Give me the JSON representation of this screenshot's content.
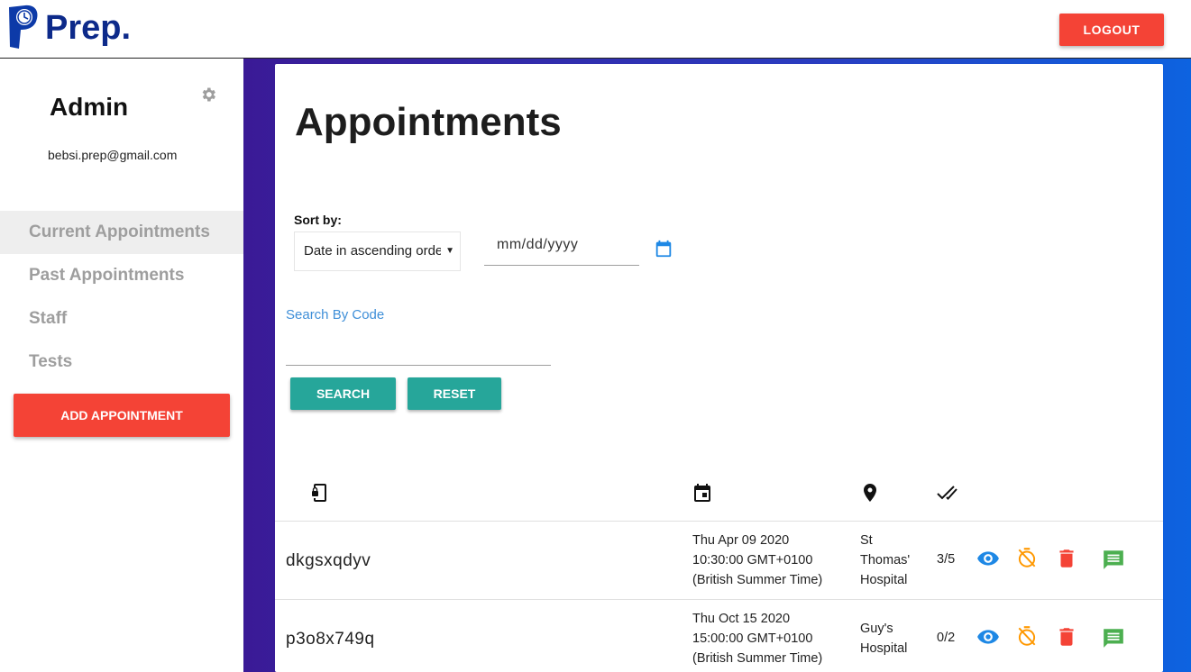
{
  "header": {
    "brand": "Prep.",
    "logout_label": "LOGOUT"
  },
  "sidebar": {
    "admin_name": "Admin",
    "admin_email": "bebsi.prep@gmail.com",
    "settings_icon": "gear-icon",
    "items": [
      {
        "label": "Current Appointments",
        "active": true
      },
      {
        "label": "Past Appointments",
        "active": false
      },
      {
        "label": "Staff",
        "active": false
      },
      {
        "label": "Tests",
        "active": false
      }
    ],
    "add_label": "ADD APPOINTMENT"
  },
  "main": {
    "title": "Appointments",
    "sort_label": "Sort by:",
    "sort_value": "Date in ascending order",
    "date_placeholder": "mm/dd/yyyy",
    "search_label": "Search By Code",
    "search_value": "",
    "search_button": "SEARCH",
    "reset_button": "RESET",
    "columns": [
      "phone-icon",
      "calendar-icon",
      "location-pin-icon",
      "checkmark-icon"
    ],
    "rows": [
      {
        "code": "dkgsxqdyv",
        "date_line1": "Thu Apr 09 2020",
        "date_line2": "10:30:00 GMT+0100",
        "date_line3": "(British Summer Time)",
        "loc_line1": "St",
        "loc_line2": "Thomas'",
        "loc_line3": "Hospital",
        "score": "3/5"
      },
      {
        "code": "p3o8x749q",
        "date_line1": "Thu Oct 15 2020",
        "date_line2": "15:00:00 GMT+0100",
        "date_line3": "(British Summer Time)",
        "loc_line1": "Guy's",
        "loc_line2": "Hospital",
        "loc_line3": "",
        "score": "0/2"
      }
    ]
  },
  "colors": {
    "brand_blue": "#0d2a8a",
    "red": "#f44336",
    "teal": "#26a69a",
    "link_blue": "#3f8fd8",
    "view_blue": "#1e88e5",
    "timer_orange": "#ff9800",
    "message_green": "#4caf50"
  }
}
